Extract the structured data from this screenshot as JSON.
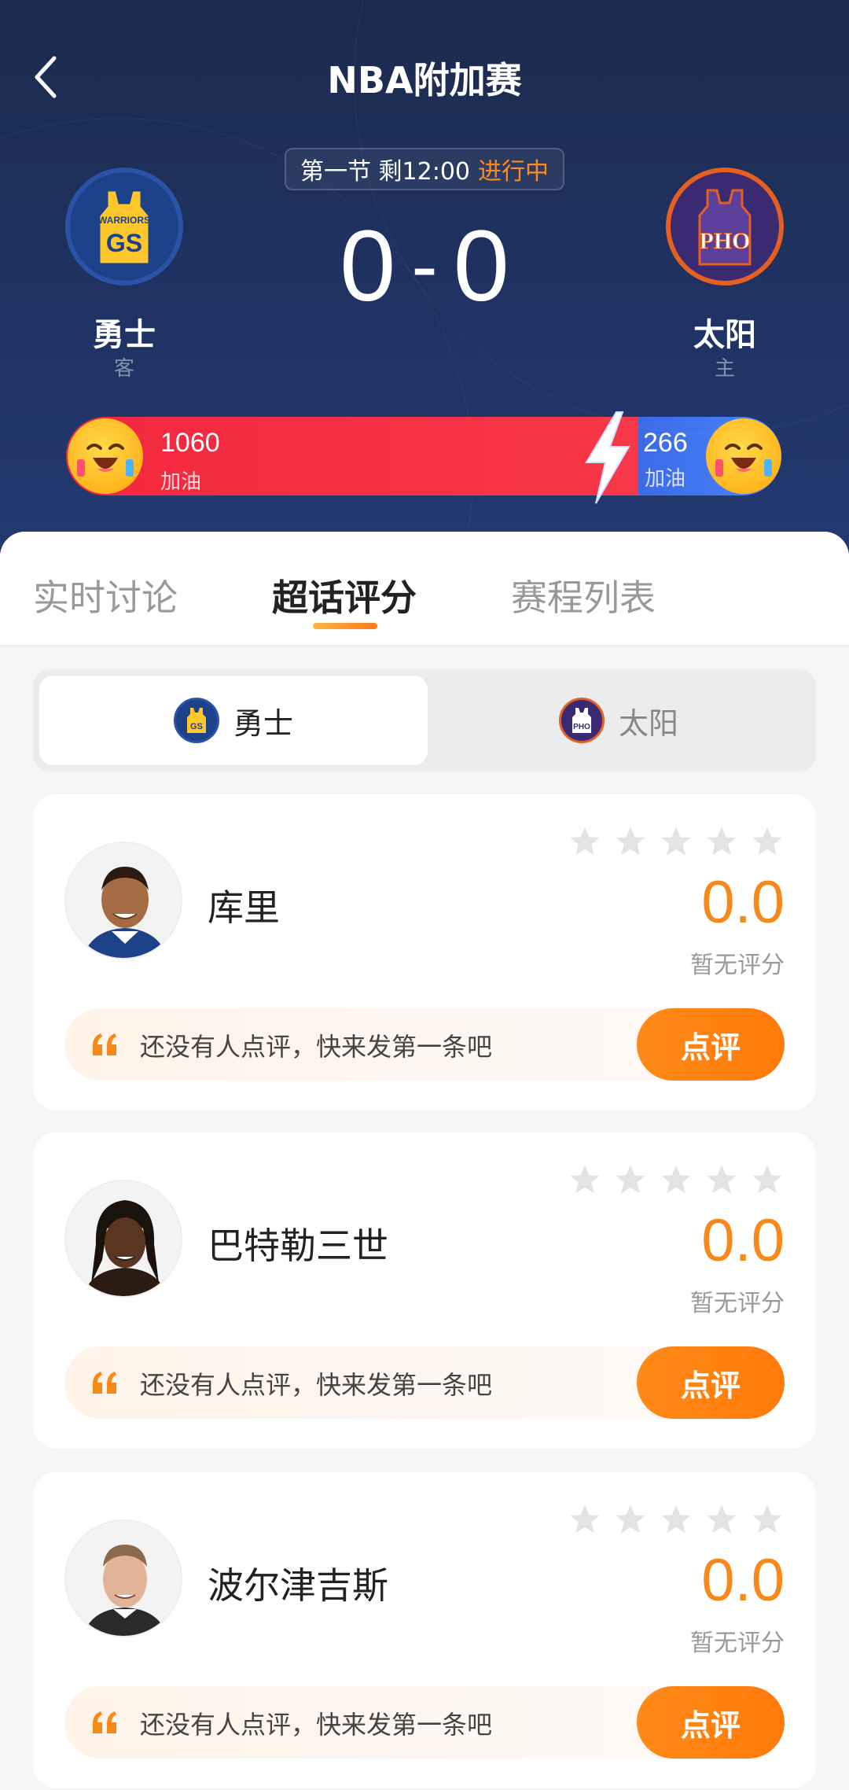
{
  "header": {
    "title": "NBA附加赛",
    "period": "第一节 剩12:00",
    "status": "进行中",
    "away_team": {
      "name": "勇士",
      "role": "客",
      "logo_text": "GS",
      "logo_sub": "WARRIORS"
    },
    "home_team": {
      "name": "太阳",
      "role": "主",
      "logo_text": "PHO"
    },
    "score": {
      "away": "0",
      "home": "0",
      "separator": "-"
    },
    "cheer": {
      "away_count": "1060",
      "away_label": "加油",
      "home_count": "266",
      "home_label": "加油",
      "away_share": 0.8
    }
  },
  "tabs": [
    "实时讨论",
    "超话评分",
    "赛程列表"
  ],
  "active_tab": 1,
  "team_switch": {
    "items": [
      "勇士",
      "太阳"
    ],
    "active": 0
  },
  "players": [
    {
      "name": "库里",
      "rating": "0.0",
      "rating_note": "暂无评分",
      "comment": "还没有人点评，快来发第一条吧",
      "button": "点评"
    },
    {
      "name": "巴特勒三世",
      "rating": "0.0",
      "rating_note": "暂无评分",
      "comment": "还没有人点评，快来发第一条吧",
      "button": "点评"
    },
    {
      "name": "波尔津吉斯",
      "rating": "0.0",
      "rating_note": "暂无评分",
      "comment": "还没有人点评，快来发第一条吧",
      "button": "点评"
    }
  ],
  "colors": {
    "accent": "#f48a1b",
    "away_bar": "#f2273f",
    "home_bar": "#4a86ff",
    "header_bg": "#1f3263"
  },
  "icons": {
    "back": "chevron-left-icon",
    "star": "star-icon",
    "quote": "quote-icon",
    "bolt": "lightning-icon"
  }
}
